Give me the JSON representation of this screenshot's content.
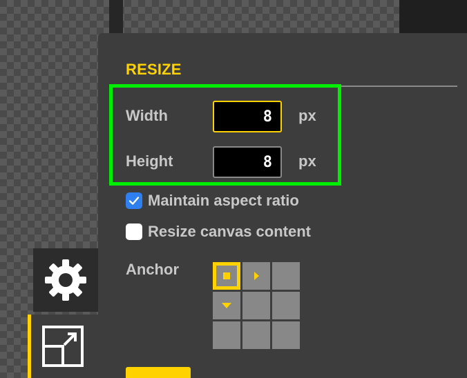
{
  "panel": {
    "title": "RESIZE"
  },
  "width": {
    "label": "Width",
    "value": "8",
    "unit": "px",
    "focused": true
  },
  "height": {
    "label": "Height",
    "value": "8",
    "unit": "px"
  },
  "options": {
    "maintain_aspect_ratio": {
      "label": "Maintain aspect ratio",
      "checked": true
    },
    "resize_canvas_content": {
      "label": "Resize canvas content",
      "checked": false
    }
  },
  "anchor": {
    "label": "Anchor",
    "selected": "top-left",
    "cells": [
      "top-left",
      "top-center",
      "top-right",
      "middle-left",
      "center",
      "middle-right",
      "bottom-left",
      "bottom-center",
      "bottom-right"
    ]
  },
  "sidebar": {
    "items": [
      {
        "icon": "gear-icon",
        "active": false
      },
      {
        "icon": "resize-icon",
        "active": true
      }
    ]
  },
  "colors": {
    "accent": "#ffd200",
    "highlight": "#00ee00",
    "checkbox_checked": "#2f7ff0",
    "panel_bg": "#3d3d3d",
    "label": "#c8c8c8"
  }
}
